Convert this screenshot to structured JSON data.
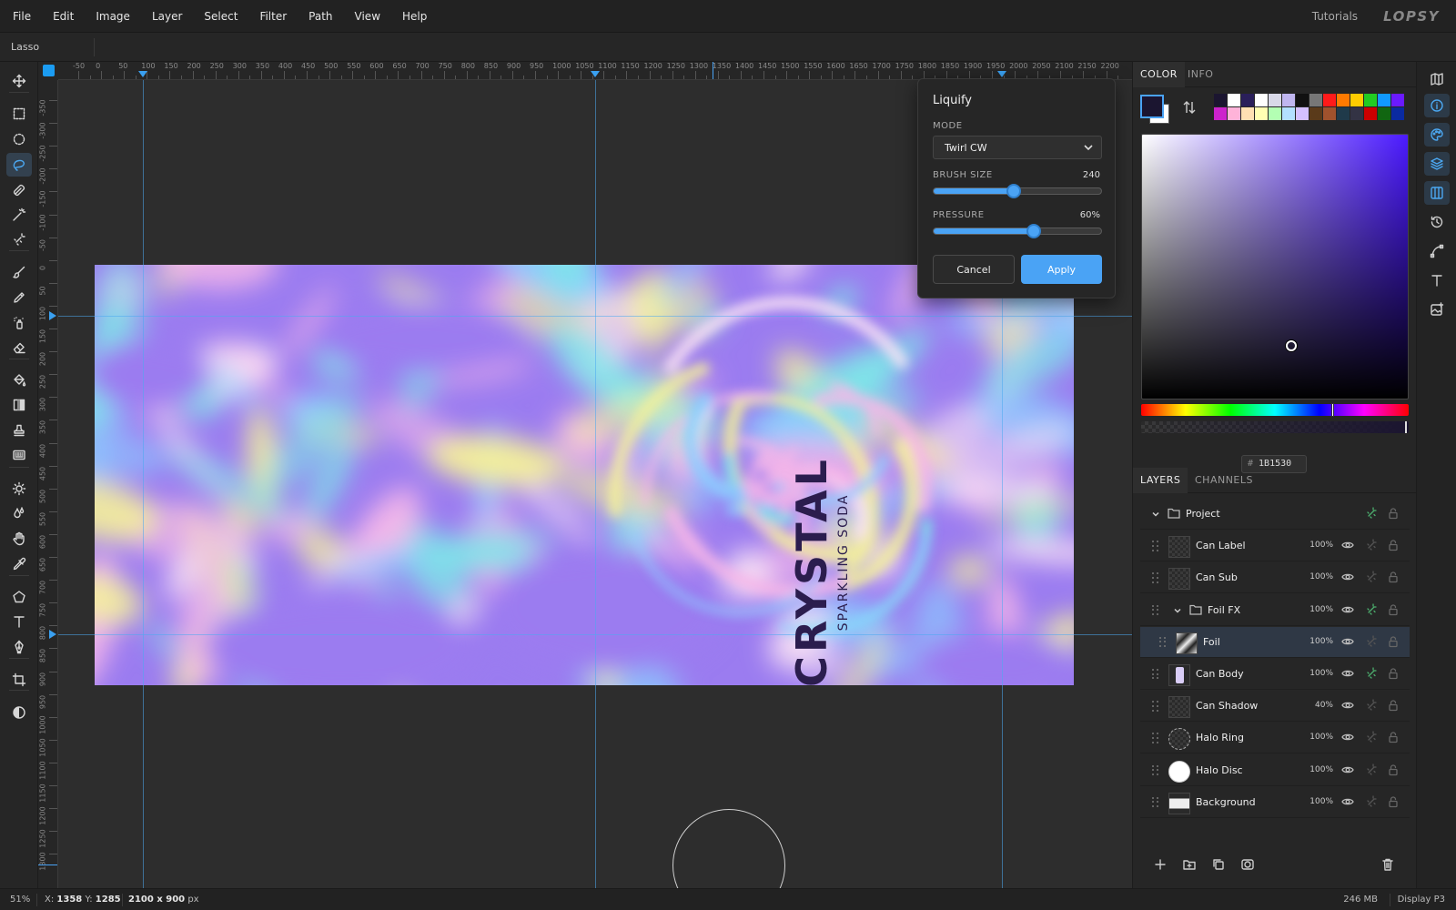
{
  "menu": [
    "File",
    "Edit",
    "Image",
    "Layer",
    "Select",
    "Filter",
    "Path",
    "View",
    "Help"
  ],
  "menu_right": {
    "tutorials": "Tutorials",
    "logo": "LOPSY"
  },
  "options_bar": {
    "tool_name": "Lasso"
  },
  "tools": [
    {
      "name": "move-tool",
      "icon": "move-icon"
    },
    {
      "name": "marquee-rect-tool",
      "icon": "rect-select-icon"
    },
    {
      "name": "marquee-ellipse-tool",
      "icon": "ellipse-select-icon"
    },
    {
      "name": "lasso-tool",
      "icon": "lasso-icon",
      "active": true
    },
    {
      "name": "quick-select-tool",
      "icon": "quick-select-icon"
    },
    {
      "name": "magic-wand-tool",
      "icon": "magic-wand-icon"
    },
    {
      "name": "object-select-tool",
      "icon": "object-select-icon"
    },
    {
      "name": "brush-tool",
      "icon": "brush-icon"
    },
    {
      "name": "pencil-tool",
      "icon": "pencil-icon"
    },
    {
      "name": "spray-tool",
      "icon": "spray-icon"
    },
    {
      "name": "eraser-tool",
      "icon": "eraser-icon"
    },
    {
      "name": "paint-bucket-tool",
      "icon": "bucket-icon"
    },
    {
      "name": "gradient-tool",
      "icon": "gradient-icon"
    },
    {
      "name": "stamp-tool",
      "icon": "stamp-icon"
    },
    {
      "name": "pattern-tool",
      "icon": "pattern-icon"
    },
    {
      "name": "dodge-tool",
      "icon": "sun-icon"
    },
    {
      "name": "blur-tool",
      "icon": "drops-icon"
    },
    {
      "name": "smudge-tool",
      "icon": "hand-icon"
    },
    {
      "name": "eyedropper-tool",
      "icon": "eyedropper-icon"
    },
    {
      "name": "shape-tool",
      "icon": "pentagon-icon"
    },
    {
      "name": "text-tool",
      "icon": "text-icon"
    },
    {
      "name": "pen-tool",
      "icon": "pen-icon"
    },
    {
      "name": "crop-tool",
      "icon": "crop-icon"
    },
    {
      "name": "mask-mode-tool",
      "icon": "contrast-icon"
    }
  ],
  "ruler_h_labels": [
    "-50",
    "0",
    "50",
    "100",
    "150",
    "200",
    "250",
    "300",
    "350",
    "400",
    "450",
    "500",
    "550",
    "600",
    "650",
    "700",
    "750",
    "800",
    "850",
    "900",
    "950",
    "1000",
    "1050",
    "1100",
    "1150",
    "1200",
    "1250",
    "1300",
    "1350",
    "1400",
    "1450",
    "1500",
    "1550",
    "1600",
    "1650",
    "1700",
    "1750",
    "1800",
    "1850",
    "1900",
    "1950",
    "2000",
    "2050",
    "2100",
    "2150",
    "2200"
  ],
  "ruler_v_labels": [
    "-350",
    "-300",
    "-250",
    "-200",
    "-150",
    "-100",
    "-50",
    "0",
    "50",
    "100",
    "150",
    "200",
    "250",
    "300",
    "350",
    "400",
    "450",
    "500",
    "550",
    "600",
    "650",
    "700",
    "750",
    "800",
    "850",
    "900",
    "950",
    "1000",
    "1050",
    "1100",
    "1150",
    "1200",
    "1250",
    "1300"
  ],
  "canvas": {
    "title": "CRYSTAL",
    "subtitle": "SPARKLING SODA",
    "foil_colors": [
      "#9b7cf0",
      "#f7b7e8",
      "#7ee7e8",
      "#f4f09a",
      "#fbe3f4",
      "#8ad0ff"
    ]
  },
  "liquify": {
    "title": "Liquify",
    "mode_label": "MODE",
    "mode_value": "Twirl CW",
    "brush_size_label": "BRUSH SIZE",
    "brush_size_value": "240",
    "brush_size_fraction": 0.48,
    "pressure_label": "PRESSURE",
    "pressure_value": "60%",
    "pressure_fraction": 0.6,
    "cancel": "Cancel",
    "apply": "Apply"
  },
  "color_panel": {
    "tabs": [
      "COLOR",
      "INFO"
    ],
    "foreground": "#1b1530",
    "background": "#ffffff",
    "palette": [
      "#1b1530",
      "#ffffff",
      "#2a1f5a",
      "#ffffff",
      "#d8d8e8",
      "#c0b6f0",
      "#111111",
      "#777777",
      "#ff1a1a",
      "#ff7a00",
      "#ffcc00",
      "#22cc22",
      "#1199ff",
      "#6a1aff",
      "#cc22cc",
      "#ffb3d9",
      "#ffe0b3",
      "#ffffb3",
      "#b3ffb3",
      "#b3e0ff",
      "#d4c0ff",
      "#5a3a1a",
      "#a0522d",
      "#1f3a4a",
      "#333344",
      "#cc0000",
      "#116611",
      "#0a2aa0"
    ],
    "hex_value": "1B1530",
    "sv_pointer": {
      "s": 0.56,
      "v": 0.2
    },
    "hue_fraction": 0.71
  },
  "layers_panel": {
    "tabs": [
      "LAYERS",
      "CHANNELS"
    ],
    "layers": [
      {
        "name": "Project",
        "type": "group",
        "opacity": "",
        "indent": 0,
        "fx": true,
        "expanded": true
      },
      {
        "name": "Can Label",
        "type": "layer",
        "opacity": "100%",
        "indent": 1,
        "fx": false,
        "thumb": "checker"
      },
      {
        "name": "Can Sub",
        "type": "layer",
        "opacity": "100%",
        "indent": 1,
        "fx": false,
        "thumb": "checker"
      },
      {
        "name": "Foil FX",
        "type": "group",
        "opacity": "100%",
        "indent": 1,
        "fx": true,
        "expanded": true
      },
      {
        "name": "Foil",
        "type": "layer",
        "opacity": "100%",
        "indent": 2,
        "fx": false,
        "thumb": "foil",
        "selected": true
      },
      {
        "name": "Can Body",
        "type": "layer",
        "opacity": "100%",
        "indent": 1,
        "fx": true,
        "thumb": "can"
      },
      {
        "name": "Can Shadow",
        "type": "layer",
        "opacity": "40%",
        "indent": 1,
        "fx": false,
        "thumb": "checker"
      },
      {
        "name": "Halo Ring",
        "type": "layer",
        "opacity": "100%",
        "indent": 1,
        "fx": false,
        "thumb": "ring"
      },
      {
        "name": "Halo Disc",
        "type": "layer",
        "opacity": "100%",
        "indent": 1,
        "fx": false,
        "thumb": "disc"
      },
      {
        "name": "Background",
        "type": "layer",
        "opacity": "100%",
        "indent": 1,
        "fx": false,
        "thumb": "bg"
      }
    ]
  },
  "status": {
    "zoom": "51%",
    "x_label": "X:",
    "x_value": "1358",
    "y_label": "Y:",
    "y_value": "1285",
    "dimensions": "2100 x 900",
    "dimensions_unit": "px",
    "memory": "246 MB",
    "color_profile": "Display P3"
  }
}
